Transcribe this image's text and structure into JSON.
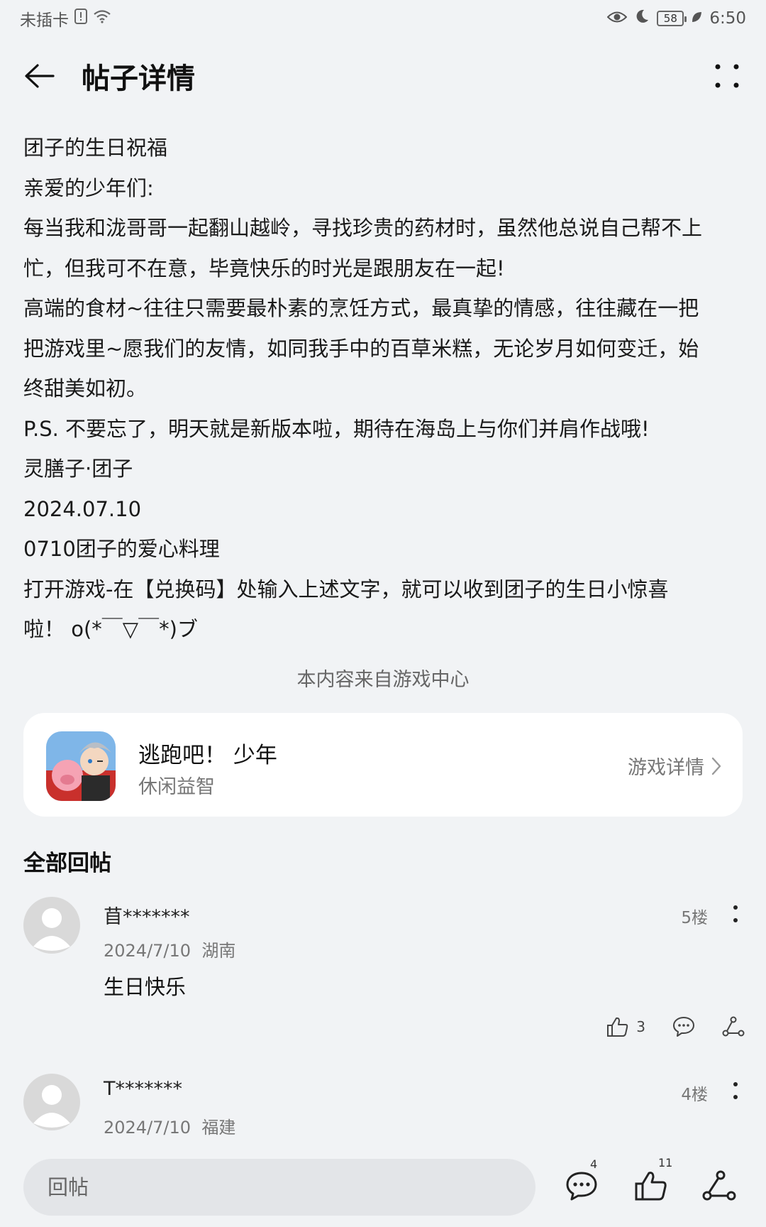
{
  "status_bar": {
    "carrier": "未插卡",
    "battery": "58",
    "time": "6:50"
  },
  "app_bar": {
    "title": "帖子详情"
  },
  "post": {
    "lines": [
      "团子的生日祝福",
      "亲爱的少年们:",
      "每当我和泷哥哥一起翻山越岭，寻找珍贵的药材时，虽然他总说自己帮不上",
      "忙，但我可不在意，毕竟快乐的时光是跟朋友在一起!",
      "高端的食材~往往只需要最朴素的烹饪方式，最真挚的情感，往往藏在一把",
      "把游戏里~愿我们的友情，如同我手中的百草米糕，无论岁月如何变迁，始",
      "终甜美如初。",
      "P.S. 不要忘了，明天就是新版本啦，期待在海岛上与你们并肩作战哦!",
      "灵膳子·团子",
      "2024.07.10",
      "0710团子的爱心料理",
      "打开游戏-在【兑换码】处输入上述文字，就可以收到团子的生日小惊喜",
      "啦！ o(*￣▽￣*)ブ"
    ]
  },
  "source_note": "本内容来自游戏中心",
  "game_card": {
    "name": "逃跑吧！ 少年",
    "genre": "休闲益智",
    "detail_link": "游戏详情"
  },
  "replies_title": "全部回帖",
  "replies": [
    {
      "user": "苜*******",
      "date": "2024/7/10",
      "location": "湖南",
      "floor": "5楼",
      "text": "生日快乐",
      "likes": "3"
    },
    {
      "user": "T*******",
      "date": "2024/7/10",
      "location": "福建",
      "floor": "4楼"
    }
  ],
  "bottom_bar": {
    "input_placeholder": "回帖",
    "comment_count": "4",
    "like_count": "11"
  }
}
